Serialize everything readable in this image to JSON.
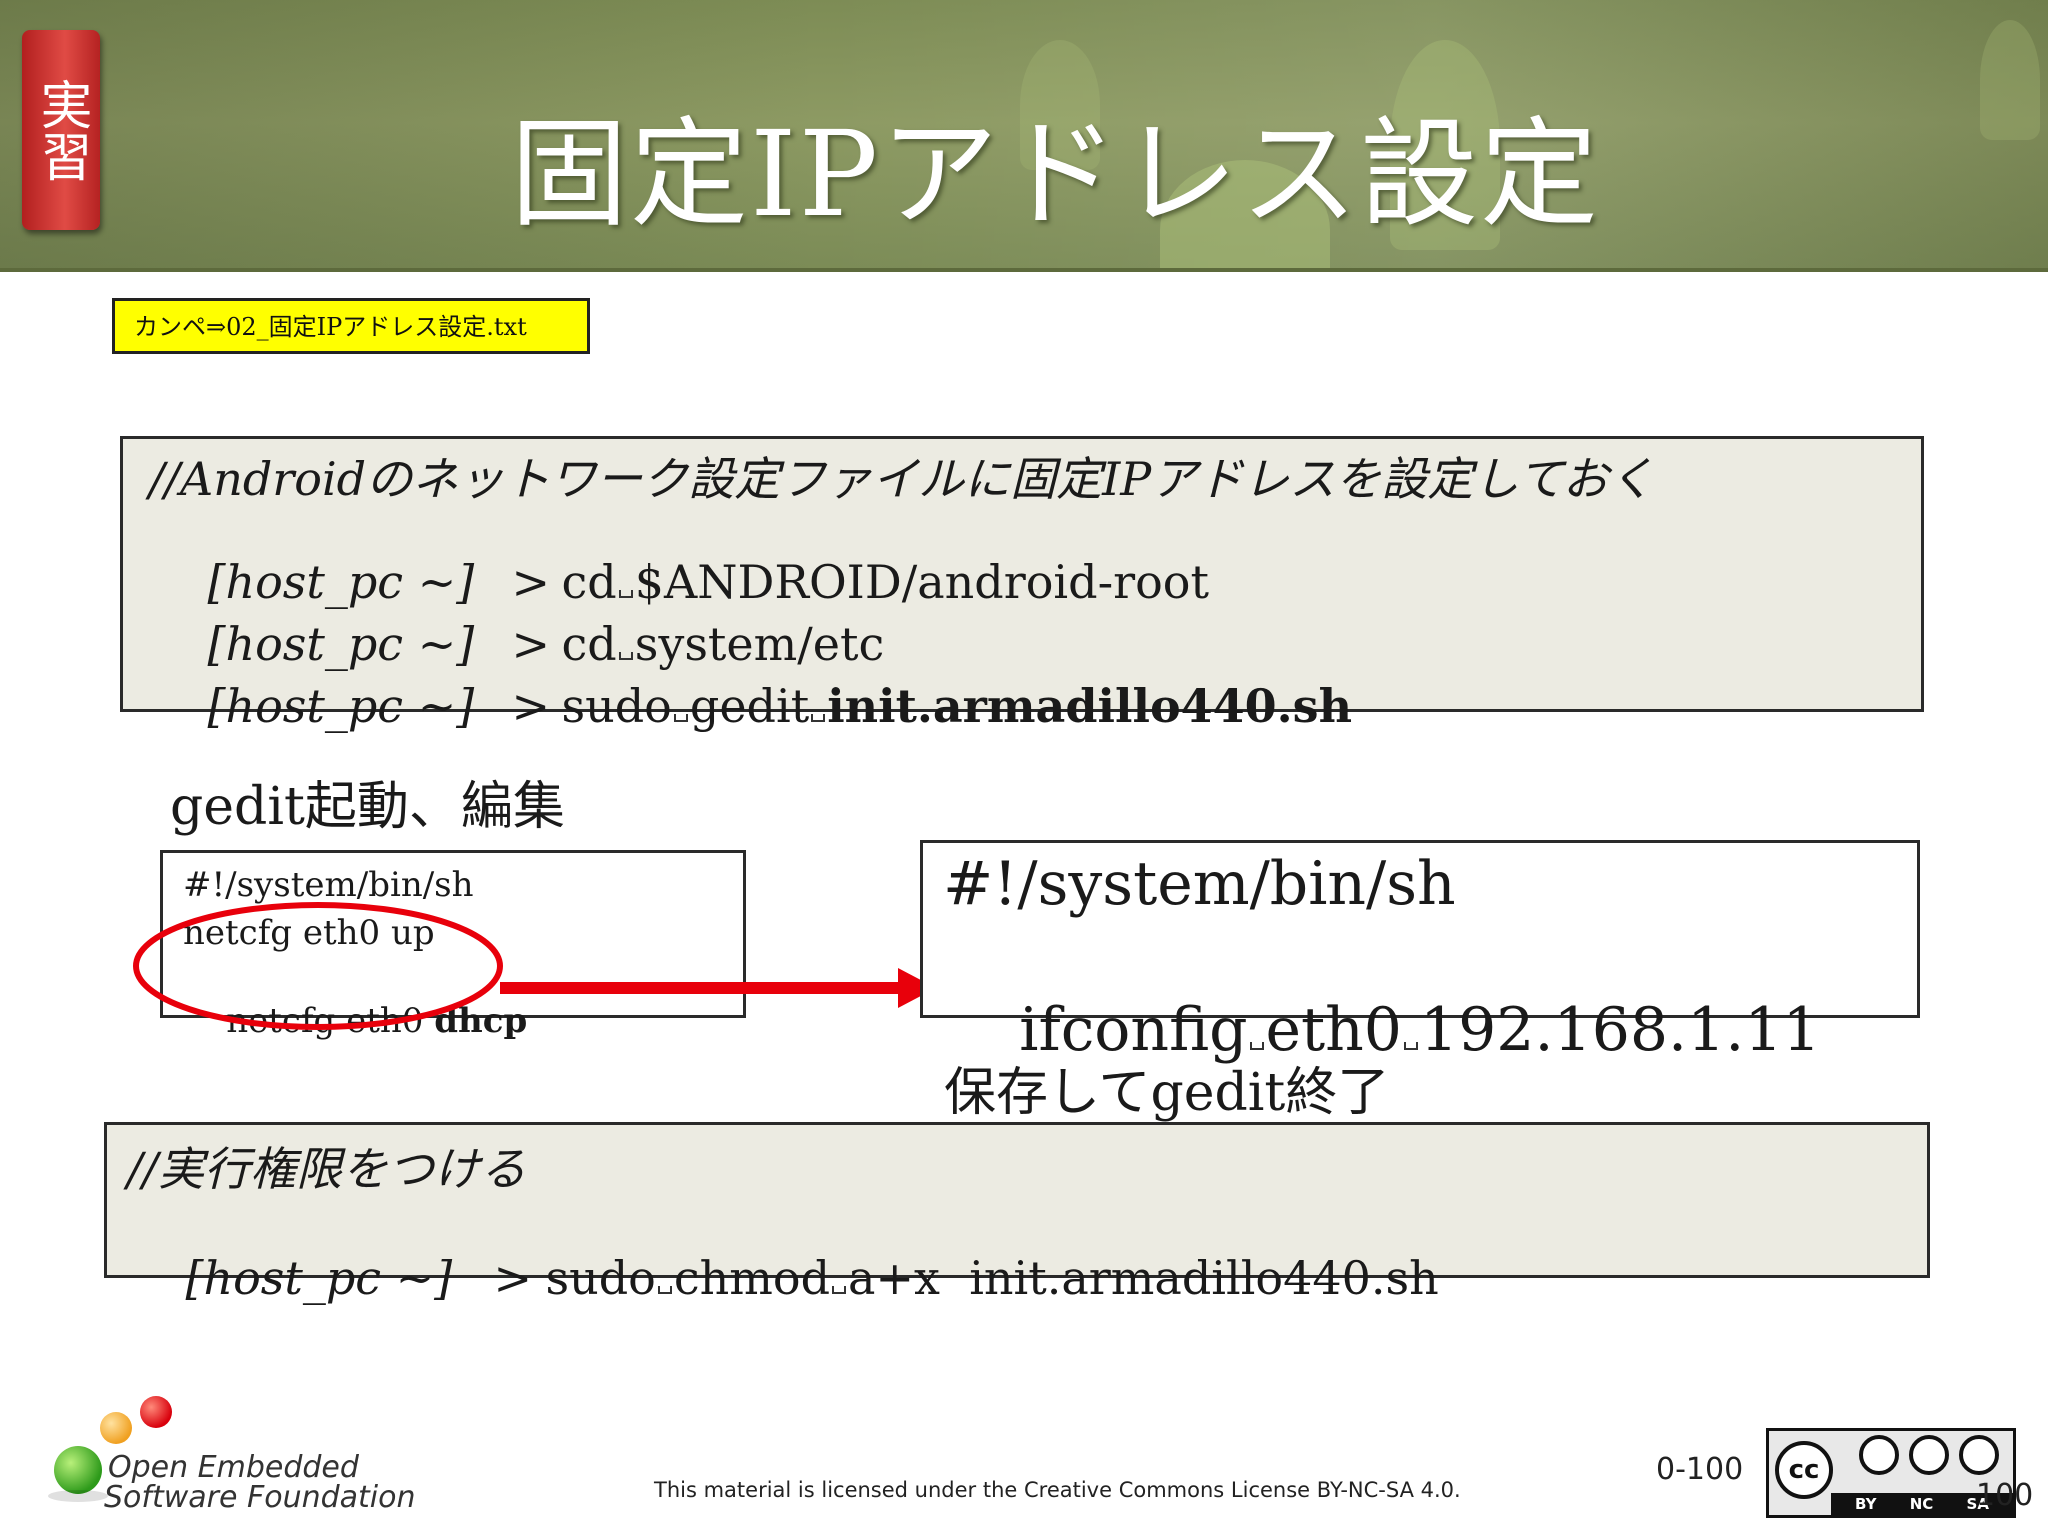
{
  "header": {
    "badge": "実習",
    "title": "固定IPアドレス設定"
  },
  "file_chip": {
    "label": "カンペ⇒02_固定IPアドレス設定.txt"
  },
  "command_block_1": {
    "comment": "//Androidのネットワーク設定ファイルに固定IPアドレスを設定しておく",
    "prompt": "[host_pc ~]",
    "arrow": ">",
    "commands": [
      [
        "cd",
        "$ANDROID/android-root"
      ],
      [
        "cd",
        "system/etc"
      ],
      [
        "sudo",
        "gedit",
        "init.armadillo440.sh"
      ]
    ]
  },
  "gedit_label": "gedit起動、編集",
  "original_file": {
    "lines": [
      "#!/system/bin/sh",
      "netcfg eth0 up",
      "netcfg eth0",
      "dhcp"
    ]
  },
  "edited_file": {
    "line1": "#!/system/bin/sh",
    "line2": [
      "ifconfig",
      "eth0",
      "192.168.1.11"
    ]
  },
  "save_label": "保存してgedit終了",
  "command_block_2": {
    "comment": "//実行権限をつける",
    "prompt": "[host_pc ~]",
    "arrow": ">",
    "command": [
      "sudo",
      "chmod",
      "a+x",
      "init.armadillo440.sh"
    ]
  },
  "footer": {
    "org_line1": "Open Embedded",
    "org_line2": "Software Foundation",
    "license": "This material is licensed under the Creative Commons License BY-NC-SA 4.0.",
    "slide_number": "0-100",
    "page_number": "100",
    "cc_label": "BY NC SA",
    "cc_icon_text": "cc"
  },
  "colors": {
    "header_green": "#7d8c55",
    "badge_red": "#c62a2a",
    "chip_yellow": "#ffff00",
    "code_bg": "#ecebe2",
    "annotation_red": "#e8000b"
  }
}
